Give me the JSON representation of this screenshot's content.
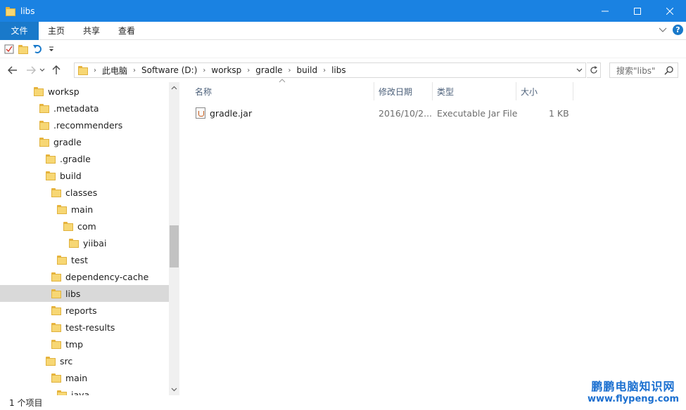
{
  "window": {
    "title": "libs",
    "minimize_glyph": "—",
    "maximize_glyph": "☐",
    "close_glyph": "✕"
  },
  "ribbon": {
    "tabs": [
      {
        "label": "文件"
      },
      {
        "label": "主页"
      },
      {
        "label": "共享"
      },
      {
        "label": "查看"
      }
    ],
    "help_glyph": "?"
  },
  "address": {
    "crumbs": [
      "此电脑",
      "Software (D:)",
      "worksp",
      "gradle",
      "build",
      "libs"
    ]
  },
  "search": {
    "placeholder": "搜索\"libs\""
  },
  "tree": {
    "items": [
      {
        "label": "worksp",
        "level": 0
      },
      {
        "label": ".metadata",
        "level": 1
      },
      {
        "label": ".recommenders",
        "level": 1
      },
      {
        "label": "gradle",
        "level": 1
      },
      {
        "label": ".gradle",
        "level": 2
      },
      {
        "label": "build",
        "level": 2
      },
      {
        "label": "classes",
        "level": 3
      },
      {
        "label": "main",
        "level": 4
      },
      {
        "label": "com",
        "level": 5
      },
      {
        "label": "yiibai",
        "level": 6
      },
      {
        "label": "test",
        "level": 4
      },
      {
        "label": "dependency-cache",
        "level": 3
      },
      {
        "label": "libs",
        "level": 3,
        "selected": true
      },
      {
        "label": "reports",
        "level": 3
      },
      {
        "label": "test-results",
        "level": 3
      },
      {
        "label": "tmp",
        "level": 3
      },
      {
        "label": "src",
        "level": 2
      },
      {
        "label": "main",
        "level": 3
      },
      {
        "label": "java",
        "level": 4
      }
    ]
  },
  "columns": {
    "name": "名称",
    "modified": "修改日期",
    "type": "类型",
    "size": "大小"
  },
  "files": [
    {
      "name": "gradle.jar",
      "modified": "2016/10/2...",
      "type": "Executable Jar File",
      "size": "1 KB"
    }
  ],
  "status": {
    "count": "1 个项目"
  },
  "watermark": {
    "line1": "鹏鹏电脑知识网",
    "line2": "www.flypeng.com"
  },
  "colors": {
    "titlebar": "#1a82e2",
    "file_tab": "#1979ca",
    "selected_row": "#d9d9d9",
    "folder": "#f7d774"
  }
}
